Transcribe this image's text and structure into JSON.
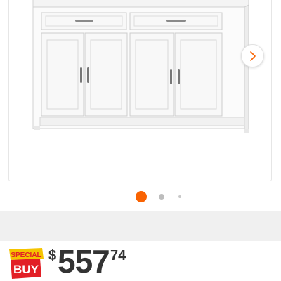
{
  "carousel": {
    "image_alt": "White sideboard cabinet with two drawers and four doors",
    "next_icon": "chevron-right-icon",
    "active_index": 1,
    "total_dots": 3
  },
  "badge": {
    "line1": "SPECIAL",
    "line2": "BUY",
    "colors": {
      "yellow": "#f5c400",
      "red": "#e21f26"
    }
  },
  "price": {
    "currency": "$",
    "dollars": "557",
    "cents": "74"
  },
  "colors": {
    "accent": "#f96302"
  }
}
